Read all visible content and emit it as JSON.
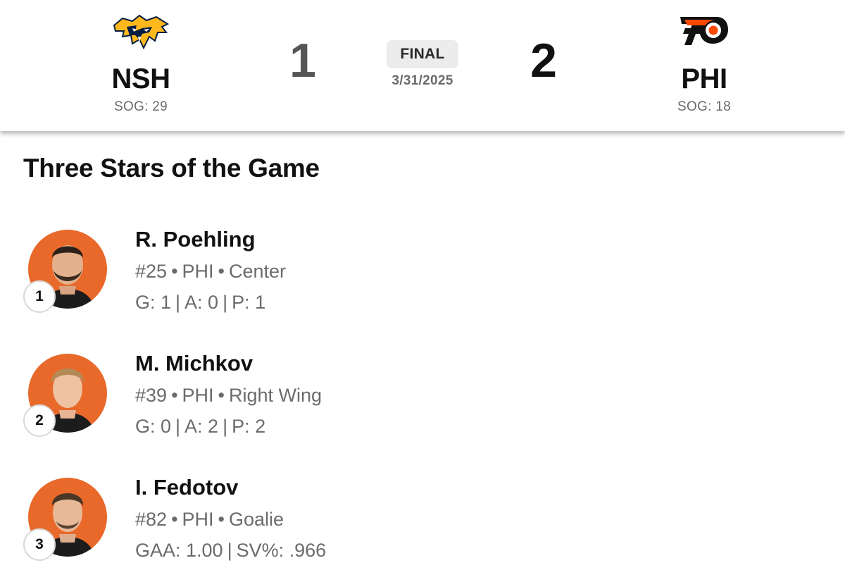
{
  "game": {
    "status": "FINAL",
    "date": "3/31/2025",
    "away": {
      "abbr": "NSH",
      "score": "1",
      "sog_label": "SOG: 29",
      "logo_icon": "predators-logo-icon",
      "colors": {
        "primary": "#FFB81C",
        "secondary": "#041E42"
      }
    },
    "home": {
      "abbr": "PHI",
      "score": "2",
      "sog_label": "SOG: 18",
      "logo_icon": "flyers-logo-icon",
      "colors": {
        "primary": "#F74902",
        "secondary": "#000000"
      }
    }
  },
  "section_title": "Three Stars of the Game",
  "stars": [
    {
      "rank": "1",
      "name": "R. Poehling",
      "number": "#25",
      "team": "PHI",
      "position": "Center",
      "stats": [
        "G: 1",
        "A: 0",
        "P: 1"
      ]
    },
    {
      "rank": "2",
      "name": "M. Michkov",
      "number": "#39",
      "team": "PHI",
      "position": "Right Wing",
      "stats": [
        "G: 0",
        "A: 2",
        "P: 2"
      ]
    },
    {
      "rank": "3",
      "name": "I. Fedotov",
      "number": "#82",
      "team": "PHI",
      "position": "Goalie",
      "stats": [
        "GAA: 1.00",
        "SV%: .966"
      ]
    }
  ],
  "colors": {
    "headshot_background": "#E8692A",
    "muted_text": "#6B6B6B",
    "status_pill": "#ECECEC"
  }
}
